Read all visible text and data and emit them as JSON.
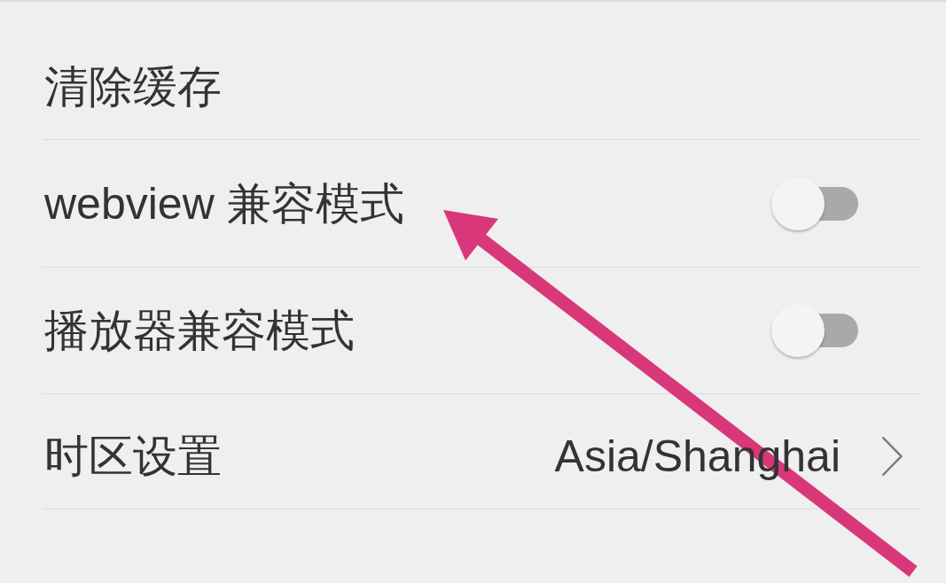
{
  "settings": [
    {
      "kind": "action",
      "label": "清除缓存"
    },
    {
      "kind": "toggle",
      "label": "webview 兼容模式",
      "on": false
    },
    {
      "kind": "toggle",
      "label": "播放器兼容模式",
      "on": false
    },
    {
      "kind": "value",
      "label": "时区设置",
      "value": "Asia/Shanghai"
    }
  ]
}
